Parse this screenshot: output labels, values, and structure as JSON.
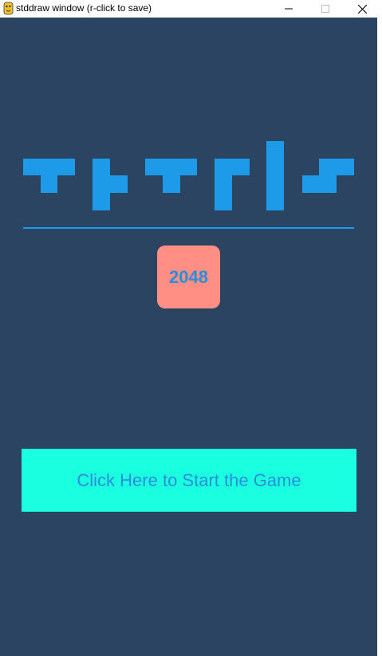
{
  "window": {
    "title": "stddraw window (r-click to save)",
    "controls": {
      "minimize_icon": "minimize-icon",
      "maximize_icon": "maximize-icon",
      "close_icon": "close-icon"
    }
  },
  "canvas": {
    "background_color": "#2a4462",
    "logo_text": "TETRIS",
    "logo_color": "#1e9be8",
    "divider_color": "#1e9be8",
    "tile": {
      "label": "2048",
      "color": "#ff8f84",
      "text_color": "#2a8fd8"
    },
    "start_button": {
      "label": "Click Here to Start the Game",
      "color": "#1affe0",
      "text_color": "#2a8fd8"
    }
  }
}
